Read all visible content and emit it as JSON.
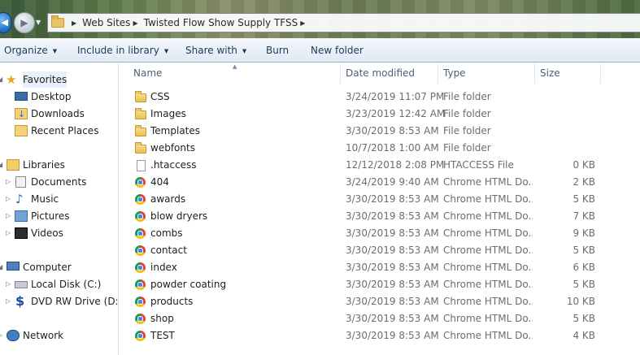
{
  "address": {
    "crumbs": [
      "Web Sites",
      "Twisted Flow Show Supply TFSS"
    ]
  },
  "toolbar": {
    "organize": "Organize",
    "include_in_library": "Include in library",
    "share_with": "Share with",
    "burn": "Burn",
    "new_folder": "New folder"
  },
  "nav": {
    "favorites": "Favorites",
    "desktop": "Desktop",
    "downloads": "Downloads",
    "recent_places": "Recent Places",
    "libraries": "Libraries",
    "documents": "Documents",
    "music": "Music",
    "pictures": "Pictures",
    "videos": "Videos",
    "computer": "Computer",
    "local_disk": "Local Disk (C:)",
    "dvd_drive": "DVD RW Drive (D:) S",
    "network": "Network"
  },
  "columns": {
    "name": "Name",
    "date_modified": "Date modified",
    "type": "Type",
    "size": "Size"
  },
  "files": [
    {
      "name": "CSS",
      "date": "3/24/2019 11:07 PM",
      "type": "File folder",
      "size": "",
      "icon": "folder-icon"
    },
    {
      "name": "Images",
      "date": "3/23/2019 12:42 AM",
      "type": "File folder",
      "size": "",
      "icon": "folder-icon"
    },
    {
      "name": "Templates",
      "date": "3/30/2019 8:53 AM",
      "type": "File folder",
      "size": "",
      "icon": "folder-icon"
    },
    {
      "name": "webfonts",
      "date": "10/7/2018 1:00 AM",
      "type": "File folder",
      "size": "",
      "icon": "folder-icon"
    },
    {
      "name": ".htaccess",
      "date": "12/12/2018 2:08 PM",
      "type": "HTACCESS File",
      "size": "0 KB",
      "icon": "file-icon"
    },
    {
      "name": "404",
      "date": "3/24/2019 9:40 AM",
      "type": "Chrome HTML Do...",
      "size": "2 KB",
      "icon": "chrome-icon"
    },
    {
      "name": "awards",
      "date": "3/30/2019 8:53 AM",
      "type": "Chrome HTML Do...",
      "size": "5 KB",
      "icon": "chrome-icon"
    },
    {
      "name": "blow dryers",
      "date": "3/30/2019 8:53 AM",
      "type": "Chrome HTML Do...",
      "size": "7 KB",
      "icon": "chrome-icon"
    },
    {
      "name": "combs",
      "date": "3/30/2019 8:53 AM",
      "type": "Chrome HTML Do...",
      "size": "9 KB",
      "icon": "chrome-icon"
    },
    {
      "name": "contact",
      "date": "3/30/2019 8:53 AM",
      "type": "Chrome HTML Do...",
      "size": "5 KB",
      "icon": "chrome-icon"
    },
    {
      "name": "index",
      "date": "3/30/2019 8:53 AM",
      "type": "Chrome HTML Do...",
      "size": "6 KB",
      "icon": "chrome-icon"
    },
    {
      "name": "powder coating",
      "date": "3/30/2019 8:53 AM",
      "type": "Chrome HTML Do...",
      "size": "5 KB",
      "icon": "chrome-icon"
    },
    {
      "name": "products",
      "date": "3/30/2019 8:53 AM",
      "type": "Chrome HTML Do...",
      "size": "10 KB",
      "icon": "chrome-icon"
    },
    {
      "name": "shop",
      "date": "3/30/2019 8:53 AM",
      "type": "Chrome HTML Do...",
      "size": "5 KB",
      "icon": "chrome-icon"
    },
    {
      "name": "TEST",
      "date": "3/30/2019 8:53 AM",
      "type": "Chrome HTML Do...",
      "size": "4 KB",
      "icon": "chrome-icon"
    }
  ]
}
